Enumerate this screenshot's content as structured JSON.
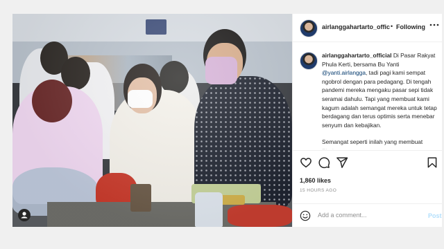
{
  "header": {
    "username": "airlanggahartarto_offic",
    "separator": "•",
    "follow_label": "Following",
    "more_icon": "more-icon"
  },
  "caption": {
    "username": "airlanggahartarto_official",
    "text_1": " Di Pasar Rakyat Phula Kerti, bersama Bu Yanti ",
    "mention": "@yanti.airlangga",
    "text_2": ", tadi pagi kami sempat ngobrol dengan para pedagang. Di tengah pandemi mereka mengaku pasar sepi tidak seramai dahulu. Tapi yang membuat kami kagum adalah semangat mereka untuk tetap berdagang dan terus optimis serta menebar senyum dan kebajikan.",
    "text_3": "Semangat seperti inilah yang membuat Phula"
  },
  "actions": {
    "like_icon": "heart-icon",
    "comment_icon": "comment-icon",
    "share_icon": "share-icon",
    "save_icon": "bookmark-icon"
  },
  "likes": "1,860 likes",
  "timestamp": "15 HOURS AGO",
  "comment": {
    "placeholder": "Add a comment...",
    "post_label": "Post",
    "emoji_icon": "emoji-icon"
  },
  "photo": {
    "badge_icon": "user-tag-icon"
  },
  "colors": {
    "link": "#00376b",
    "post_disabled": "#b2dffc",
    "muted": "#8e8e8e"
  }
}
